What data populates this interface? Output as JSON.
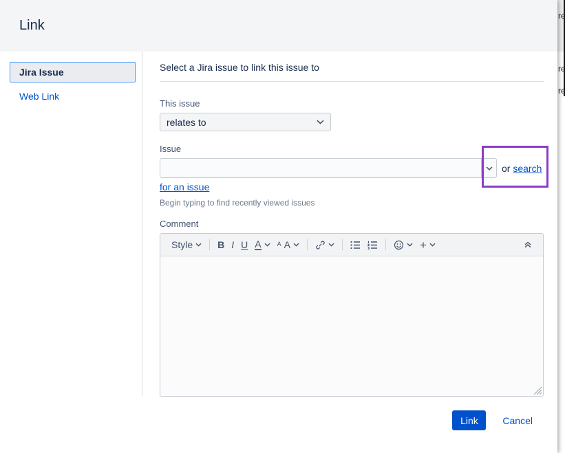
{
  "background": {
    "fragments": [
      "re",
      "re",
      "re"
    ]
  },
  "dialog": {
    "title": "Link",
    "sidebar": {
      "items": [
        {
          "label": "Jira Issue",
          "selected": true
        },
        {
          "label": "Web Link",
          "selected": false
        }
      ]
    },
    "description": "Select a Jira issue to link this issue to",
    "fields": {
      "this_issue_label": "This issue",
      "link_type_value": "relates to",
      "issue_label": "Issue",
      "issue_input_value": "",
      "or_text": "or ",
      "search_link": "search",
      "search_link_wrap": "for an issue",
      "helper_text": "Begin typing to find recently viewed issues",
      "comment_label": "Comment"
    },
    "toolbar": {
      "style_label": "Style",
      "bold_label": "B",
      "italic_label": "I",
      "underline_label": "U",
      "color_label": "A",
      "font_label": "A"
    },
    "footer": {
      "link_button_label": "Link",
      "cancel_label": "Cancel"
    }
  },
  "icons": {
    "insert_plus": "+",
    "style_chevron": "chevron-down",
    "link_icon": "link-chain",
    "bullet_list_icon": "bullet-list",
    "numbered_list_icon": "numbered-list",
    "emoji_icon": "emoji-smiley",
    "collapse_icon": "double-chevron-up",
    "resize_icon": "resize-grip"
  },
  "colors": {
    "primary_button": "#0052cc",
    "link_text": "#0052cc",
    "annotation_border": "#8b3cc8",
    "header_bg": "#f4f5f7",
    "selected_item_border": "#4c9aff"
  }
}
